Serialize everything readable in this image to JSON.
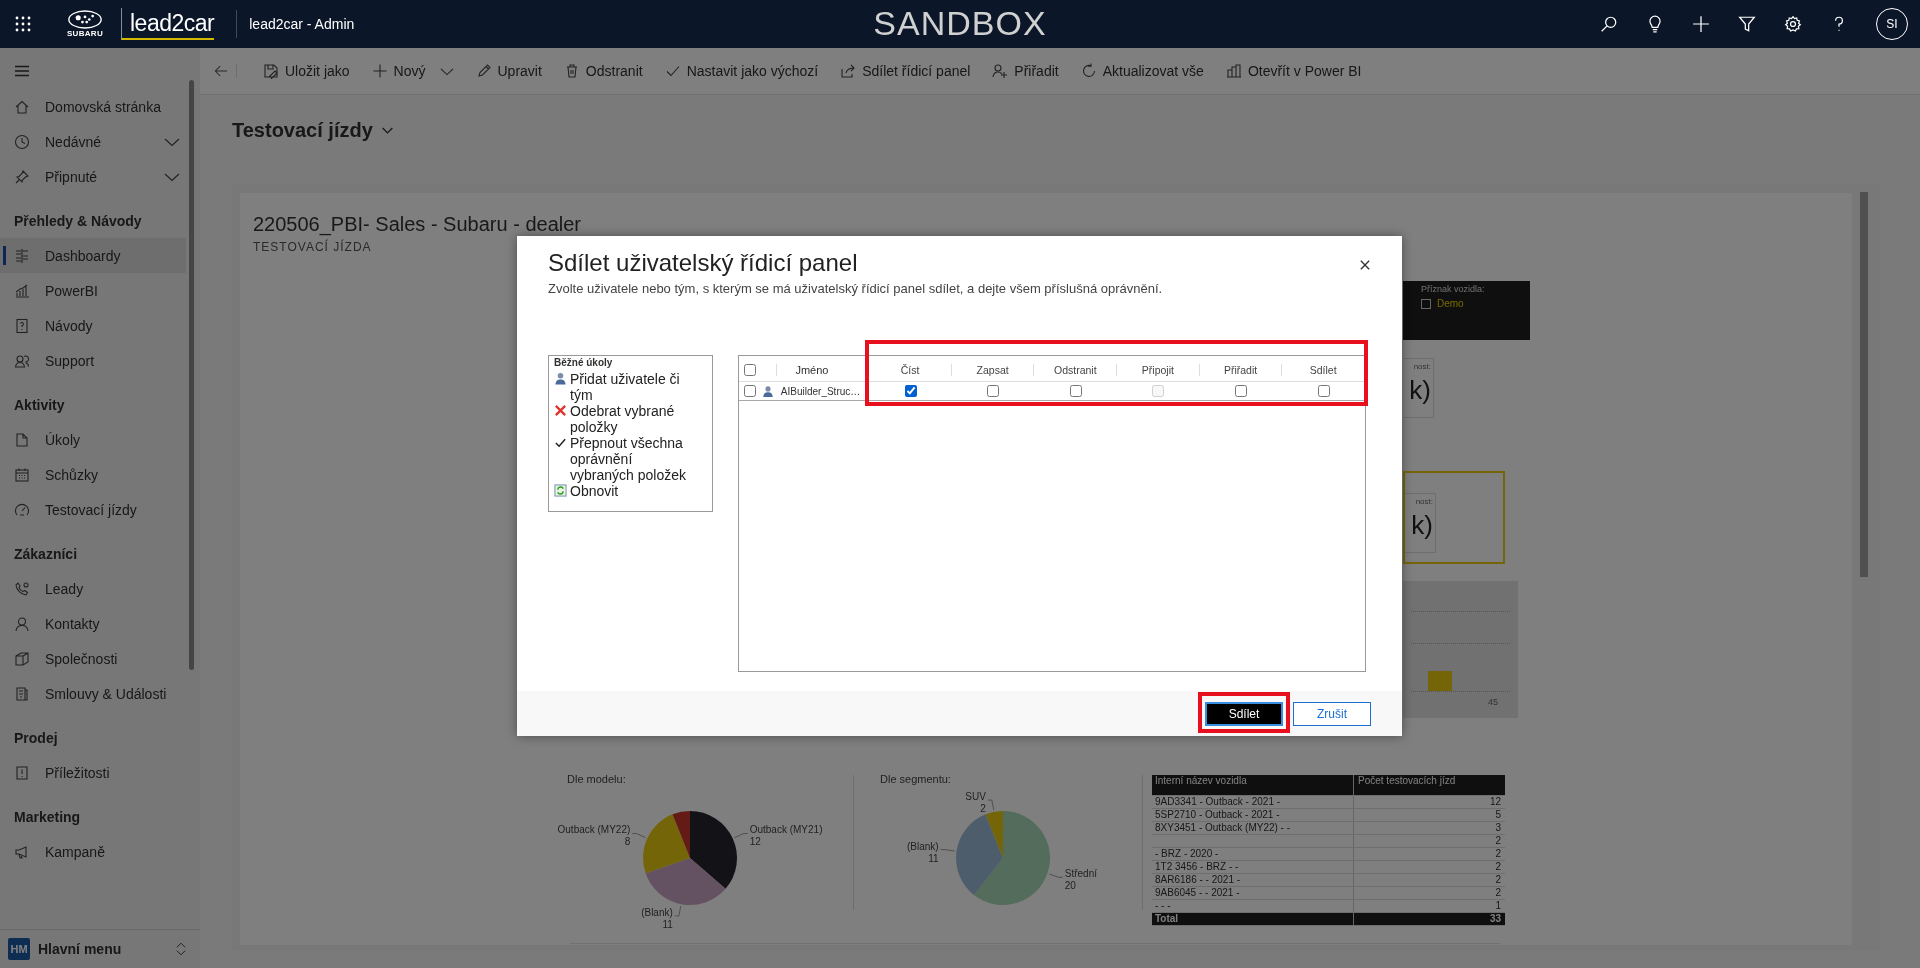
{
  "top_bar": {
    "brand": "SUBARU",
    "app_logo": "lead2car",
    "app_title": "lead2car - Admin",
    "environment": "SANDBOX",
    "avatar": "SI"
  },
  "sidebar": {
    "sections": [
      {
        "items": [
          {
            "label": "Domovská stránka",
            "selected": false,
            "expandable": false
          },
          {
            "label": "Nedávné",
            "selected": false,
            "expandable": true
          },
          {
            "label": "Připnuté",
            "selected": false,
            "expandable": true
          }
        ]
      },
      {
        "title": "Přehledy & Návody",
        "items": [
          {
            "label": "Dashboardy",
            "selected": true,
            "expandable": false
          },
          {
            "label": "PowerBI",
            "selected": false,
            "expandable": false
          },
          {
            "label": "Návody",
            "selected": false,
            "expandable": false
          },
          {
            "label": "Support",
            "selected": false,
            "expandable": false
          }
        ]
      },
      {
        "title": "Aktivity",
        "items": [
          {
            "label": "Úkoly",
            "selected": false,
            "expandable": false
          },
          {
            "label": "Schůzky",
            "selected": false,
            "expandable": false
          },
          {
            "label": "Testovací jízdy",
            "selected": false,
            "expandable": false
          }
        ]
      },
      {
        "title": "Zákazníci",
        "items": [
          {
            "label": "Leady",
            "selected": false,
            "expandable": false
          },
          {
            "label": "Kontakty",
            "selected": false,
            "expandable": false
          },
          {
            "label": "Společnosti",
            "selected": false,
            "expandable": false
          },
          {
            "label": "Smlouvy & Události",
            "selected": false,
            "expandable": false
          }
        ]
      },
      {
        "title": "Prodej",
        "items": [
          {
            "label": "Příležitosti",
            "selected": false,
            "expandable": false
          }
        ]
      },
      {
        "title": "Marketing",
        "items": [
          {
            "label": "Kampaně",
            "selected": false,
            "expandable": false
          }
        ]
      }
    ],
    "footer": {
      "initials": "HM",
      "label": "Hlavní menu"
    }
  },
  "command_bar": [
    {
      "label": "Uložit jako",
      "has_menu": false
    },
    {
      "label": "Nový",
      "has_menu": true
    },
    {
      "label": "Upravit",
      "has_menu": false
    },
    {
      "label": "Odstranit",
      "has_menu": false
    },
    {
      "label": "Nastavit jako výchozí",
      "has_menu": false
    },
    {
      "label": "Sdílet řídicí panel",
      "has_menu": false
    },
    {
      "label": "Přiřadit",
      "has_menu": false
    },
    {
      "label": "Aktualizovat vše",
      "has_menu": false
    },
    {
      "label": "Otevřít v Power BI",
      "has_menu": false
    }
  ],
  "page_title": "Testovací jízdy",
  "report": {
    "title": "220506_PBI- Sales - Subaru - dealer",
    "subtitle": "TESTOVACÍ JÍZDA",
    "slicer": {
      "label": "Příznak vozidla:",
      "options": [
        {
          "label": "Demo",
          "checked": false
        }
      ]
    },
    "cards": [
      {
        "label": "nost:",
        "value": "k)",
        "highlighted": false
      },
      {
        "label": "nost:",
        "value": "k)",
        "highlighted": true
      }
    ],
    "bar_chart": {
      "tick_label": "45"
    },
    "model_chart": {
      "chart_data": {
        "type": "pie",
        "title": "Dle modelu:",
        "categories": [
          "Outback (MY21)",
          "(Blank)",
          "Outback (MY22)",
          null
        ],
        "values": [
          12,
          11,
          8,
          2
        ],
        "value_labels": [
          "12",
          "11",
          "8",
          null
        ]
      }
    },
    "segment_chart": {
      "chart_data": {
        "type": "pie",
        "title": "Dle segmentu:",
        "categories": [
          "Střední",
          "(Blank)",
          "SUV"
        ],
        "values": [
          20,
          11,
          2
        ],
        "value_labels": [
          "20",
          "11",
          "2"
        ]
      }
    },
    "table": {
      "columns": [
        "Interní název vozidla",
        "Počet testovacích jízd"
      ],
      "rows": [
        {
          "name": "9AD3341 - Outback - 2021 -",
          "count": "12"
        },
        {
          "name": "5SP2710 - Outback - 2021 -",
          "count": "5"
        },
        {
          "name": "8XY3451 - Outback (MY22) - -",
          "count": "3"
        },
        {
          "count": "2"
        },
        {
          "name": "- BRZ - 2020 -",
          "count": "2"
        },
        {
          "name": "1T2 3456 - BRZ - -",
          "count": "2"
        },
        {
          "name": "8AR6186 - - 2021 -",
          "count": "2"
        },
        {
          "name": "9AB6045 - - 2021 -",
          "count": "2"
        },
        {
          "name": "- - -",
          "count": "1"
        }
      ],
      "total": {
        "label": "Total",
        "count": "33"
      }
    }
  },
  "dialog": {
    "title": "Sdílet uživatelský řídicí panel",
    "subtitle": "Zvolte uživatele nebo tým, s kterým se má uživatelský řídicí panel sdílet, a dejte všem příslušná oprávnění.",
    "tasks": {
      "title": "Běžné úkoly",
      "items": [
        "Přidat uživatele či tým",
        "Odebrat vybrané položky",
        "Přepnout všechna oprávnění vybraných položek",
        "Obnovit"
      ]
    },
    "grid": {
      "select_all": false,
      "columns": [
        "Jméno",
        "Číst",
        "Zapsat",
        "Odstranit",
        "Připojit",
        "Přiřadit",
        "Sdílet"
      ],
      "rows": [
        {
          "selected": false,
          "name": "AIBuilder_Struc…",
          "permissions": [
            {
              "checked": true,
              "disabled": false
            },
            {
              "checked": false,
              "disabled": false
            },
            {
              "checked": false,
              "disabled": false
            },
            {
              "checked": false,
              "disabled": true
            },
            {
              "checked": false,
              "disabled": false
            },
            {
              "checked": false,
              "disabled": false
            }
          ]
        }
      ]
    },
    "buttons": [
      {
        "label": "Sdílet",
        "kind": "primary"
      },
      {
        "label": "Zrušit",
        "kind": "secondary"
      }
    ]
  }
}
